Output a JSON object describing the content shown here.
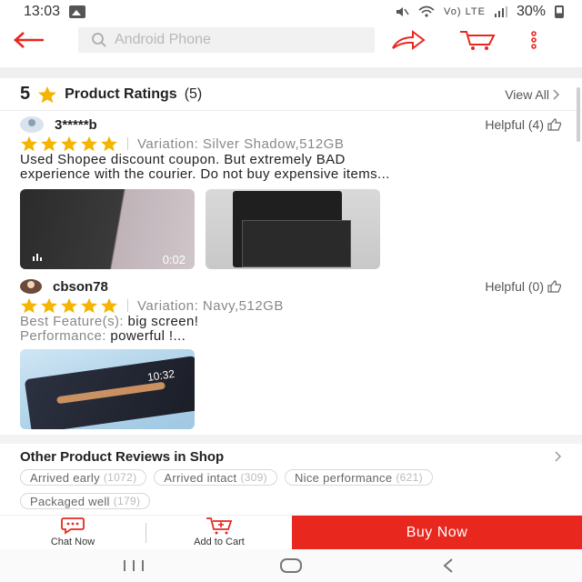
{
  "status_bar": {
    "time": "13:03",
    "signal_text": "Vo) LTE",
    "battery": "30%"
  },
  "header": {
    "search_placeholder": "Android Phone"
  },
  "ratings": {
    "score": "5",
    "label": "Product Ratings",
    "count": "(5)",
    "view_all": "View All"
  },
  "reviews": [
    {
      "name": "3*****b",
      "helpful": "Helpful (4)",
      "stars": 5,
      "variation": "Variation: Silver Shadow,512GB",
      "line1": "Used Shopee discount coupon. But extremely BAD",
      "line2": "experience with the courier. Do not buy expensive items...",
      "video_duration": "0:02"
    },
    {
      "name": "cbson78",
      "helpful": "Helpful (0)",
      "stars": 5,
      "variation": "Variation: Navy,512GB",
      "feature_label": "Best Feature(s):",
      "feature_value": "big screen!",
      "performance_label": "Performance:",
      "performance_value": "powerful !...",
      "photo_clock": "10:32"
    }
  ],
  "other_reviews": {
    "title": "Other Product Reviews in Shop",
    "chips": [
      {
        "label": "Arrived early",
        "count": "(1072)"
      },
      {
        "label": "Arrived intact",
        "count": "(309)"
      },
      {
        "label": "Nice performance",
        "count": "(621)"
      },
      {
        "label": "Packaged well",
        "count": "(179)"
      }
    ]
  },
  "bottom_bar": {
    "chat_label": "Chat Now",
    "cart_label": "Add to Cart",
    "buy_label": "Buy Now"
  },
  "colors": {
    "accent": "#e8281e",
    "star": "#f5b400"
  }
}
